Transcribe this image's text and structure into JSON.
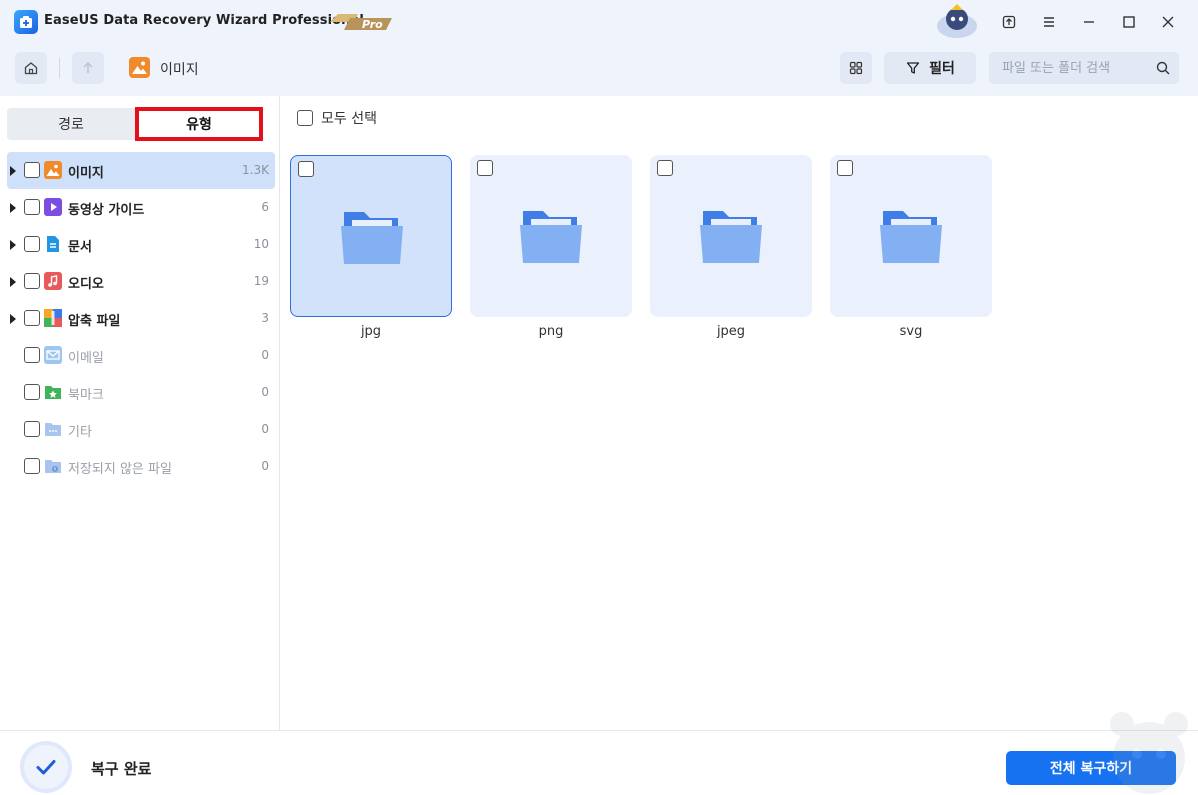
{
  "app": {
    "title": "EaseUS Data Recovery Wizard Professional",
    "badge": "Pro"
  },
  "toolbar": {
    "breadcrumb": "이미지",
    "filter_label": "필터",
    "search_placeholder": "파일 또는 폴더 검색"
  },
  "sidebar": {
    "tabs": [
      {
        "label": "경로"
      },
      {
        "label": "유형"
      }
    ],
    "active_tab": "유형",
    "items": [
      {
        "label": "이미지",
        "count": "1.3K",
        "icon": "image-icon",
        "color": "#f18a2b",
        "expandable": true,
        "selected": true
      },
      {
        "label": "동영상 가이드",
        "count": "6",
        "icon": "video-icon",
        "color": "#7b4de2",
        "expandable": true
      },
      {
        "label": "문서",
        "count": "10",
        "icon": "document-icon",
        "color": "#2196e6",
        "expandable": true
      },
      {
        "label": "오디오",
        "count": "19",
        "icon": "audio-icon",
        "color": "#e85a5a",
        "expandable": true
      },
      {
        "label": "압축 파일",
        "count": "3",
        "icon": "archive-icon",
        "color": "#3b7be8",
        "expandable": true
      },
      {
        "label": "이메일",
        "count": "0",
        "icon": "email-icon",
        "color": "#9ec7ef",
        "expandable": false
      },
      {
        "label": "북마크",
        "count": "0",
        "icon": "bookmark-icon",
        "color": "#41b45a",
        "expandable": false
      },
      {
        "label": "기타",
        "count": "0",
        "icon": "other-icon",
        "color": "#a9c4ee",
        "expandable": false
      },
      {
        "label": "저장되지 않은 파일",
        "count": "0",
        "icon": "unsaved-file-icon",
        "color": "#a9c4ee",
        "expandable": false
      }
    ]
  },
  "main": {
    "select_all_label": "모두 선택",
    "folders": [
      {
        "name": "jpg",
        "active": true
      },
      {
        "name": "png"
      },
      {
        "name": "jpeg"
      },
      {
        "name": "svg"
      }
    ]
  },
  "footer": {
    "status_label": "복구 완료",
    "recover_all_label": "전체 복구하기"
  },
  "colors": {
    "accent": "#1672f0",
    "highlight": "#e3101a",
    "panel_bg": "#eef3fc"
  }
}
